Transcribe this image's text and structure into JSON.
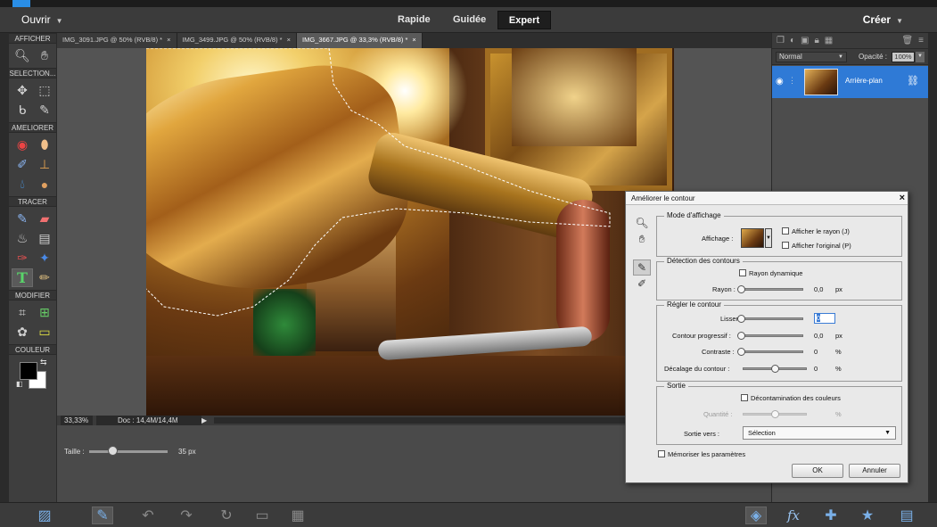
{
  "modebar": {
    "open_label": "Ouvrir",
    "modes": [
      "Rapide",
      "Guidée",
      "Expert"
    ],
    "active_mode": "Expert",
    "create_label": "Créer"
  },
  "toolbox": {
    "sections": {
      "view": "AFFICHER",
      "select": "SELECTION...",
      "enhance": "AMELIORER",
      "draw": "TRACER",
      "modify": "MODIFIER",
      "color": "COULEUR"
    },
    "foreground_color": "#000000",
    "background_color": "#ffffff"
  },
  "doc_tabs": [
    {
      "label": "IMG_3091.JPG @ 50% (RVB/8) *",
      "close": "×"
    },
    {
      "label": "IMG_3499.JPG @ 50% (RVB/8) *",
      "close": "×"
    },
    {
      "label": "IMG_3667.JPG @ 33,3% (RVB/8) *",
      "close": "×"
    }
  ],
  "statusbar": {
    "zoom": "33,33%",
    "doc": "Doc : 14,4M/14,4M"
  },
  "tool_options": {
    "size_label": "Taille :",
    "size_value": "35 px",
    "size_fraction": 0.3
  },
  "layers": {
    "blend_mode": "Normal",
    "opacity_label": "Opacité :",
    "opacity_value": "100%",
    "layer_name": "Arrière-plan"
  },
  "dialog": {
    "title": "Améliorer le contour",
    "close": "×",
    "view_mode": {
      "legend": "Mode d'affichage",
      "display_label": "Affichage :",
      "show_radius": "Afficher le rayon (J)",
      "show_original": "Afficher l'original (P)"
    },
    "edge_detection": {
      "legend": "Détection des contours",
      "smart_radius": "Rayon dynamique",
      "radius_label": "Rayon :",
      "radius_value": "0,0",
      "radius_unit": "px"
    },
    "adjust_edge": {
      "legend": "Régler le contour",
      "smooth_label": "Lisser :",
      "smooth_value": "0",
      "feather_label": "Contour progressif :",
      "feather_value": "0,0",
      "feather_unit": "px",
      "contrast_label": "Contraste :",
      "contrast_value": "0",
      "contrast_unit": "%",
      "shift_label": "Décalage du contour :",
      "shift_value": "0",
      "shift_unit": "%"
    },
    "output": {
      "legend": "Sortie",
      "decontaminate": "Décontamination des couleurs",
      "amount_label": "Quantité :",
      "amount_unit": "%",
      "output_to_label": "Sortie vers :",
      "output_to_value": "Sélection"
    },
    "remember": "Mémoriser les paramètres",
    "ok": "OK",
    "cancel": "Annuler"
  }
}
